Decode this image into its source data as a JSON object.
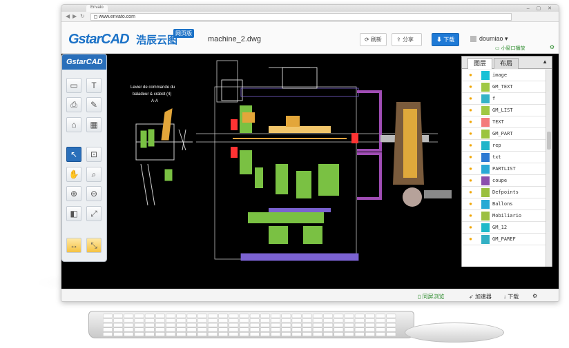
{
  "browser": {
    "tab_title": "Envato",
    "url": "www.envato.com",
    "controls": "– ▢ ✕"
  },
  "header": {
    "logo_text": "GstarCAD",
    "logo_cn": "浩辰云图",
    "logo_badge": "网页版",
    "filename": "machine_2.dwg",
    "refresh_label": "刷新",
    "share_label": "分享",
    "download_label": "下载",
    "username": "doumiao",
    "mini_play_label": "小窗口播放"
  },
  "toolbar": {
    "title": "GstarCAD"
  },
  "drawing": {
    "annotation_line1": "Levier de commande du",
    "annotation_line2": "baladeur & crabot (4)",
    "annotation_line3": "A-A"
  },
  "layers": {
    "tab_layers": "图层",
    "tab_layout": "布局",
    "items": [
      {
        "name": "image",
        "color": "#19c1d6"
      },
      {
        "name": "GM_TEXT",
        "color": "#a0c843"
      },
      {
        "name": "f",
        "color": "#34b3c7"
      },
      {
        "name": "GM_LIST",
        "color": "#a0c843"
      },
      {
        "name": "TEXT",
        "color": "#f37b7b"
      },
      {
        "name": "GM_PART",
        "color": "#9bc43f"
      },
      {
        "name": "rep",
        "color": "#1fb5c9"
      },
      {
        "name": "txt",
        "color": "#2c79d2"
      },
      {
        "name": "PARTLIST",
        "color": "#2aa8d5"
      },
      {
        "name": "coupe",
        "color": "#8b4fae"
      },
      {
        "name": "Defpoints",
        "color": "#9ac03f"
      },
      {
        "name": "Ballons",
        "color": "#27a9d4"
      },
      {
        "name": "Mobiliario",
        "color": "#9cc043"
      },
      {
        "name": "GM_12",
        "color": "#1fb9c9"
      },
      {
        "name": "GM_PAREF",
        "color": "#33b0c4"
      }
    ]
  },
  "statusbar": {
    "split_label": "同屏浏览",
    "accel_label": "加速器",
    "download_label": "下载"
  }
}
